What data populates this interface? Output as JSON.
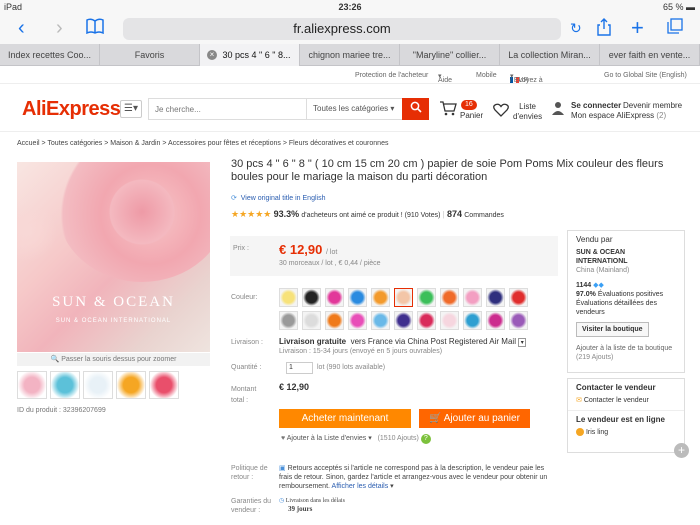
{
  "status_bar": {
    "device": "iPad",
    "time": "23:26",
    "battery": "65 %"
  },
  "browser": {
    "url": "fr.aliexpress.com",
    "tabs": [
      "Index recettes Coo...",
      "Favoris",
      "30 pcs 4 \" 6 \" 8...",
      "chignon mariee tre...",
      "\"Maryline\" collier...",
      "La collection Miran...",
      "ever faith en vente..."
    ]
  },
  "top_strip": {
    "protection": "Protection de l'acheteur",
    "help": "Aide",
    "mobile": "Mobile",
    "ship_to": "Envoyez à",
    "currency": "/ EUR",
    "global": "Go to Global Site (English)"
  },
  "header": {
    "logo": "AliExpress",
    "search_placeholder": "Je cherche...",
    "category_select": "Toutes les catégories",
    "cart_count": "16",
    "cart_label": "Panier",
    "wishlist_line1": "Liste",
    "wishlist_line2": "d'envies",
    "signin": "Se connecter",
    "register": "Devenir membre",
    "my_account": "Mon espace AliExpress",
    "account_count": "(2)"
  },
  "breadcrumb": "Accueil > Toutes catégories > Maison & Jardin > Accessoires pour fêtes et réceptions > Fleurs décoratives et couronnes",
  "gallery": {
    "brand": "SUN & OCEAN",
    "brand_sub": "SUN & OCEAN INTERNATIONAL",
    "hover_hint": "Passer la souris dessus pour zoomer",
    "product_id": "ID du produit : 32396207699",
    "thumb_colors": [
      "#f3b3c3",
      "#5cc1d9",
      "#e8f1f7",
      "#f5a623",
      "#e94f6b"
    ]
  },
  "product": {
    "title": "30 pcs 4 \" 6 \" 8 \" ( 10 cm 15 cm 20 cm ) papier de soie Pom Poms Mix couleur des fleurs boules pour le mariage la maison du parti décoration",
    "view_original": "View original title in English",
    "stars": "★★★★★",
    "rating_pct": "93.3%",
    "rating_text": "d'acheteurs ont aimé ce produit ! (910 Votes)",
    "orders_count": "874",
    "orders_label": "Commandes",
    "price_label": "Prix :",
    "price": "€ 12,90",
    "price_unit": "/ lot",
    "price_sub": "30 morceaux / lot , € 0,44 / pièce",
    "color_label": "Couleur:",
    "swatch_colors": [
      "#f7e27a",
      "#222222",
      "#e2389a",
      "#2a8be0",
      "#f39a2c",
      "#f3c6a8",
      "#3cbf5a",
      "#f06b2a",
      "#f39fc2",
      "#2f2f7e",
      "#e02d2d",
      "#9a9a9a",
      "#dcdcdc",
      "#f07a1a",
      "#e84eb8",
      "#6ab9e8",
      "#3f2f8e",
      "#d92b5b",
      "#f6d6df",
      "#2e9fd1",
      "#cc2b8e",
      "#9a5ab8"
    ],
    "shipping_label": "Livraison :",
    "shipping_free": "Livraison gratuite",
    "shipping_via": "vers France via China Post Registered Air Mail",
    "shipping_sub": "Livraison : 15-34 jours (envoyé en 5 jours ouvrables)",
    "qty_label": "Quantité :",
    "qty_value": "1",
    "qty_available": "lot (990 lots available)",
    "total_label": "Montant total :",
    "total": "€ 12,90",
    "buy_now": "Acheter maintenant",
    "add_to_cart": "Ajouter au panier",
    "add_wishlist": "Ajouter à la Liste d'envies",
    "wishlist_count": "(1510 Ajouts)",
    "returns_label": "Politique de retour :",
    "returns_text": "Retours acceptés si l'article ne correspond pas à la description, le vendeur paie les frais de retour. Sinon, gardez l'article et arrangez-vous avec le vendeur pour obtenir un remboursement.",
    "returns_link": "Afficher les détails",
    "guarantee_label": "Garanties du vendeur :",
    "guarantee_line1": "Livraison dans les délais",
    "guarantee_line2": "39 jours"
  },
  "seller": {
    "sold_by": "Vendu par",
    "name": "SUN & OCEAN INTERNATIONL",
    "location": "China (Mainland)",
    "score": "1144",
    "positive_pct": "97.0%",
    "positive_label": "Évaluations positives",
    "detailed": "Évaluations détaillées des vendeurs",
    "visit_store": "Visiter la boutique",
    "add_favorites": "Ajouter à la liste de ta boutique",
    "favorites_count": "(219 Ajouts)",
    "contact_title": "Contacter le vendeur",
    "contact_link": "Contacter le vendeur",
    "online_title": "Le vendeur est en ligne",
    "online_name": "Iris ling"
  }
}
